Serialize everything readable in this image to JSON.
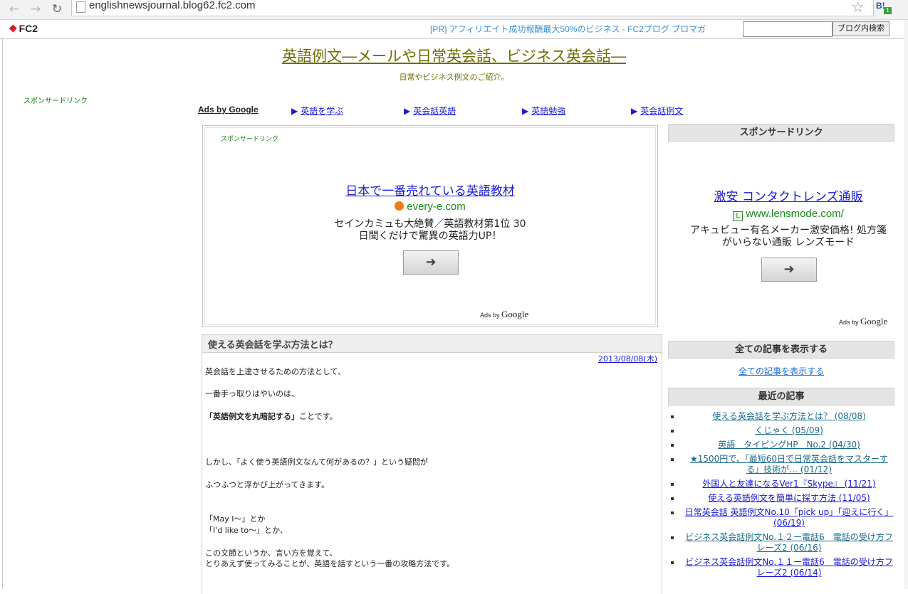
{
  "browser": {
    "url": "englishnewsjournal.blog62.fc2.com",
    "ext_label": "B!",
    "ext_badge": "1"
  },
  "fc2bar": {
    "logo": "FC2",
    "pr_text": "[PR] アフィリエイト成功報酬最大50%のビジネス - FC2ブログ ブロマガ",
    "search_button": "ブログ内検索",
    "search_value": ""
  },
  "header": {
    "title": "英語例文―メールや日常英会話、ビジネス英会話―",
    "description": "日常やビジネス例文のご紹介。"
  },
  "left": {
    "sponsor": "スポンサードリンク"
  },
  "link_units": {
    "ads_by": "Ads by Google",
    "items": [
      "英語を学ぶ",
      "英会話英語",
      "英語勉強",
      "英会話例文"
    ]
  },
  "main_ad": {
    "sponsor": "スポンサードリンク",
    "title": "日本で一番売れている英語教材",
    "url": "every-e.com",
    "desc_line1": "セインカミュも大絶賛／英語教材第1位 30",
    "desc_line2": "日聞くだけで驚異の英語力UP！",
    "ads_by": "Ads by",
    "google": "Google"
  },
  "article": {
    "title": "使える英会話を学ぶ方法とは？",
    "date": "2013/08/08(木)",
    "lines": [
      "英会話を上達させるための方法として、",
      "一番手っ取りはやいのは、",
      "「英語例文を丸暗記する」",
      "ことです。",
      "しかし、「よく使う英語例文なんて何があるの？」という疑問が",
      "ふつふつと浮かび上がってきます。",
      "「May I〜」とか",
      "「I'd like to〜」とか、",
      "この文節というか、言い方を覚えて、",
      "とりあえず使ってみることが、英語を話すという一番の攻略方法です。"
    ]
  },
  "sidebar": {
    "sponsor_head": "スポンサードリンク",
    "ad": {
      "title": "激安 コンタクトレンズ通販",
      "url": "www.lensmode.com/",
      "desc_line1": "アキュビュー有名メーカー激安価格! 処方箋",
      "desc_line2": "がいらない通販 レンズモード",
      "ads_by": "Ads by",
      "google": "Google"
    },
    "all_head": "全ての記事を表示する",
    "all_link": "全ての記事を表示する",
    "recent_head": "最近の記事",
    "recent": [
      "使える英会話を学ぶ方法とは？ (08/08)",
      "くじゃく (05/09)",
      "英語　タイピングHP　No.2 (04/30)",
      "★1500円で、「最短60日で日常英会話をマスターする」技術が… (01/12)",
      "外国人と友達になるVer1『Skype』 (11/21)",
      "使える英語例文を簡単に探す方法 (11/05)",
      "日常英会話 英語例文No.10「pick up」「迎えに行く」 (06/19)",
      "ビジネス英会話例文No.１２ー電話6　電話の受け方フレーズ2 (06/16)",
      "ビジネス英会話例文No.１１ー電話6　電話の受け方フレーズ2 (06/14)"
    ]
  }
}
